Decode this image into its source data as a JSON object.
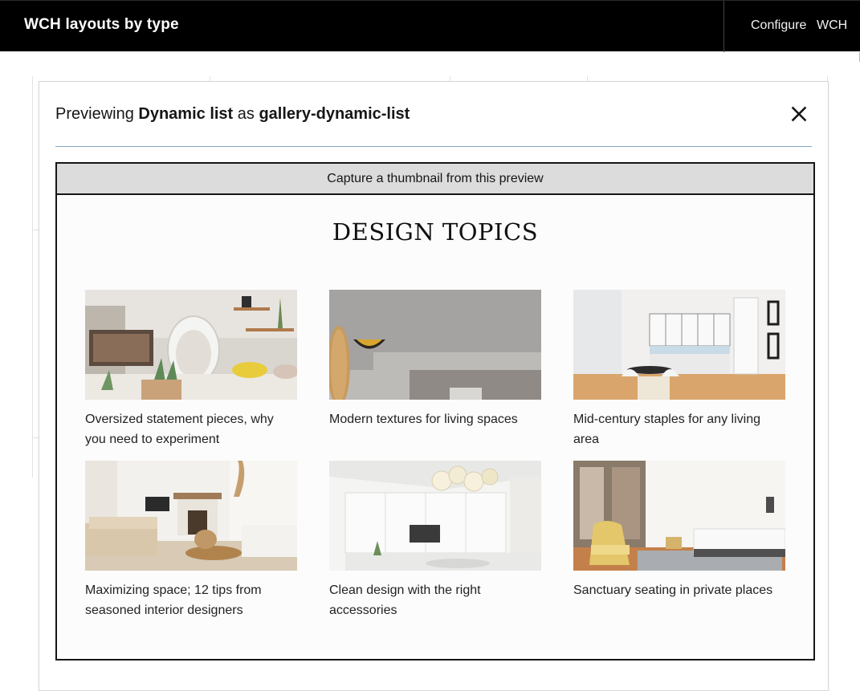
{
  "topbar": {
    "title": "WCH layouts by type",
    "nav": {
      "configure": "Configure",
      "wch": "WCH"
    }
  },
  "modal": {
    "title_prefix": "Previewing",
    "content_name": "Dynamic list",
    "title_middle": "as",
    "layout_name": "gallery-dynamic-list",
    "close_icon": "close-icon"
  },
  "preview": {
    "capture_label": "Capture a thumbnail from this preview",
    "heading": "DESIGN TOPICS",
    "cards": [
      {
        "caption": "Oversized statement pieces, why you need to experiment",
        "image": "living-room-egg-chair-photo"
      },
      {
        "caption": "Modern textures for living spaces",
        "image": "concrete-fireplace-vase-photo"
      },
      {
        "caption": "Mid-century staples for any living area",
        "image": "white-kitchen-dining-photo"
      },
      {
        "caption": "Maximizing space; 12 tips from seasoned interior designers",
        "image": "beige-living-room-fireplace-photo"
      },
      {
        "caption": "Clean design with the right accessories",
        "image": "white-media-wall-photo"
      },
      {
        "caption": "Sanctuary seating in private places",
        "image": "bedroom-yellow-armchair-photo"
      }
    ]
  },
  "colors": {
    "topbar_bg": "#000000",
    "divider": "#7fa8c4",
    "capture_bar_bg": "#dcdcdc"
  }
}
